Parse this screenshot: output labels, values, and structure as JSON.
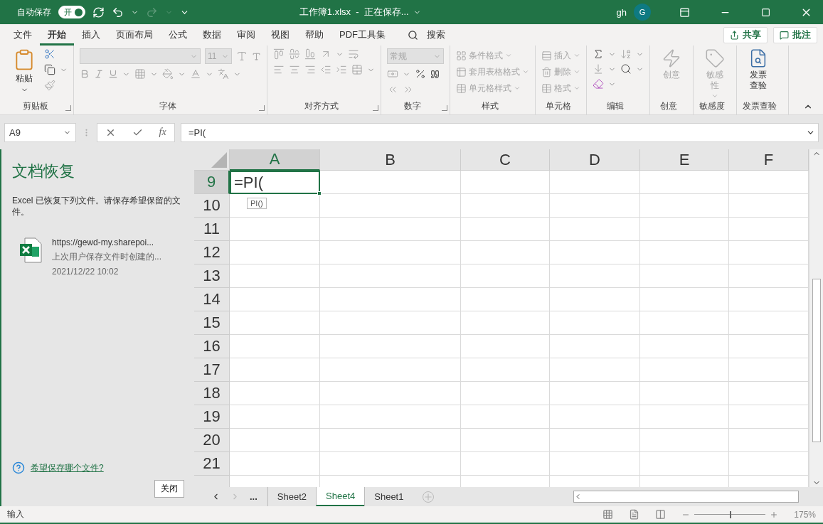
{
  "title_bar": {
    "autosave_label": "自动保存",
    "autosave": {
      "label": "开",
      "on": true
    },
    "title": "工作簿1.xlsx  -  正在保存...",
    "user": "gh",
    "avatar": "G"
  },
  "menu_tabs": [
    {
      "label": "文件",
      "selected": false
    },
    {
      "label": "开始",
      "selected": true
    },
    {
      "label": "插入",
      "selected": false
    },
    {
      "label": "页面布局",
      "selected": false
    },
    {
      "label": "公式",
      "selected": false
    },
    {
      "label": "数据",
      "selected": false
    },
    {
      "label": "审阅",
      "selected": false
    },
    {
      "label": "视图",
      "selected": false
    },
    {
      "label": "帮助",
      "selected": false
    },
    {
      "label": "PDF工具集",
      "selected": false
    }
  ],
  "search": {
    "label": "搜索"
  },
  "share": {
    "label": "共享"
  },
  "comments": {
    "label": "批注"
  },
  "ribbon": [
    {
      "kind": "clipboard",
      "label": "剪贴板",
      "launcher": true,
      "paste": "粘贴"
    },
    {
      "kind": "font",
      "label": "字体",
      "launcher": true,
      "size": "11"
    },
    {
      "kind": "alignment",
      "label": "对齐方式",
      "launcher": true
    },
    {
      "kind": "number",
      "label": "数字",
      "launcher": true,
      "format": "常规"
    },
    {
      "kind": "list",
      "label": "样式",
      "launcher": false,
      "items": [
        {
          "text": "条件格式",
          "disabled": true
        },
        {
          "text": "套用表格格式",
          "disabled": true
        },
        {
          "text": "单元格样式",
          "disabled": true
        }
      ]
    },
    {
      "kind": "list",
      "label": "单元格",
      "launcher": false,
      "items": [
        {
          "text": "插入",
          "disabled": true
        },
        {
          "text": "删除",
          "disabled": true
        },
        {
          "text": "格式",
          "disabled": true
        }
      ]
    },
    {
      "kind": "editing",
      "label": "编辑",
      "launcher": false
    },
    {
      "kind": "big",
      "label": "创意",
      "launcher": false,
      "text": "创意",
      "disabled": true,
      "caret": false
    },
    {
      "kind": "big",
      "label": "敏感度",
      "launcher": false,
      "text": "敏感性",
      "disabled": true,
      "caret": true
    },
    {
      "kind": "big",
      "label": "发票查验",
      "launcher": false,
      "text": "发票查验",
      "disabled": false,
      "caret": false
    }
  ],
  "formula_bar": {
    "name_box": "A9",
    "fx": "fx",
    "formula": "=PI("
  },
  "recovery": {
    "title": "文档恢复",
    "message": "Excel 已恢复下列文件。请保存希望保留的文件。",
    "file": {
      "name": "https://gewd-my.sharepoi...",
      "description": "上次用户保存文件时创建的...",
      "date": "2021/12/22 10:02"
    },
    "help_link": "希望保存哪个文件?",
    "close": "关闭"
  },
  "grid": {
    "columns": [
      {
        "label": "A",
        "selected": true
      },
      {
        "label": "B",
        "selected": false
      },
      {
        "label": "C",
        "selected": false
      },
      {
        "label": "D",
        "selected": false
      },
      {
        "label": "E",
        "selected": false
      },
      {
        "label": "F",
        "selected": false
      }
    ],
    "rows": [
      {
        "label": "9",
        "selected": true
      },
      {
        "label": "10",
        "selected": false
      },
      {
        "label": "11",
        "selected": false
      },
      {
        "label": "12",
        "selected": false
      },
      {
        "label": "13",
        "selected": false
      },
      {
        "label": "14",
        "selected": false
      },
      {
        "label": "15",
        "selected": false
      },
      {
        "label": "16",
        "selected": false
      },
      {
        "label": "17",
        "selected": false
      },
      {
        "label": "18",
        "selected": false
      },
      {
        "label": "19",
        "selected": false
      },
      {
        "label": "20",
        "selected": false
      },
      {
        "label": "21",
        "selected": false
      }
    ],
    "active_cell": "=PI(",
    "tooltip": "PI()"
  },
  "sheet_tabs": {
    "more": "...",
    "tabs": [
      {
        "label": "Sheet2",
        "selected": false
      },
      {
        "label": "Sheet4",
        "selected": true
      },
      {
        "label": "Sheet1",
        "selected": false
      }
    ]
  },
  "status_bar": {
    "mode": "输入",
    "zoom_slider": {
      "level": 0.5
    },
    "zoom": "175%"
  }
}
